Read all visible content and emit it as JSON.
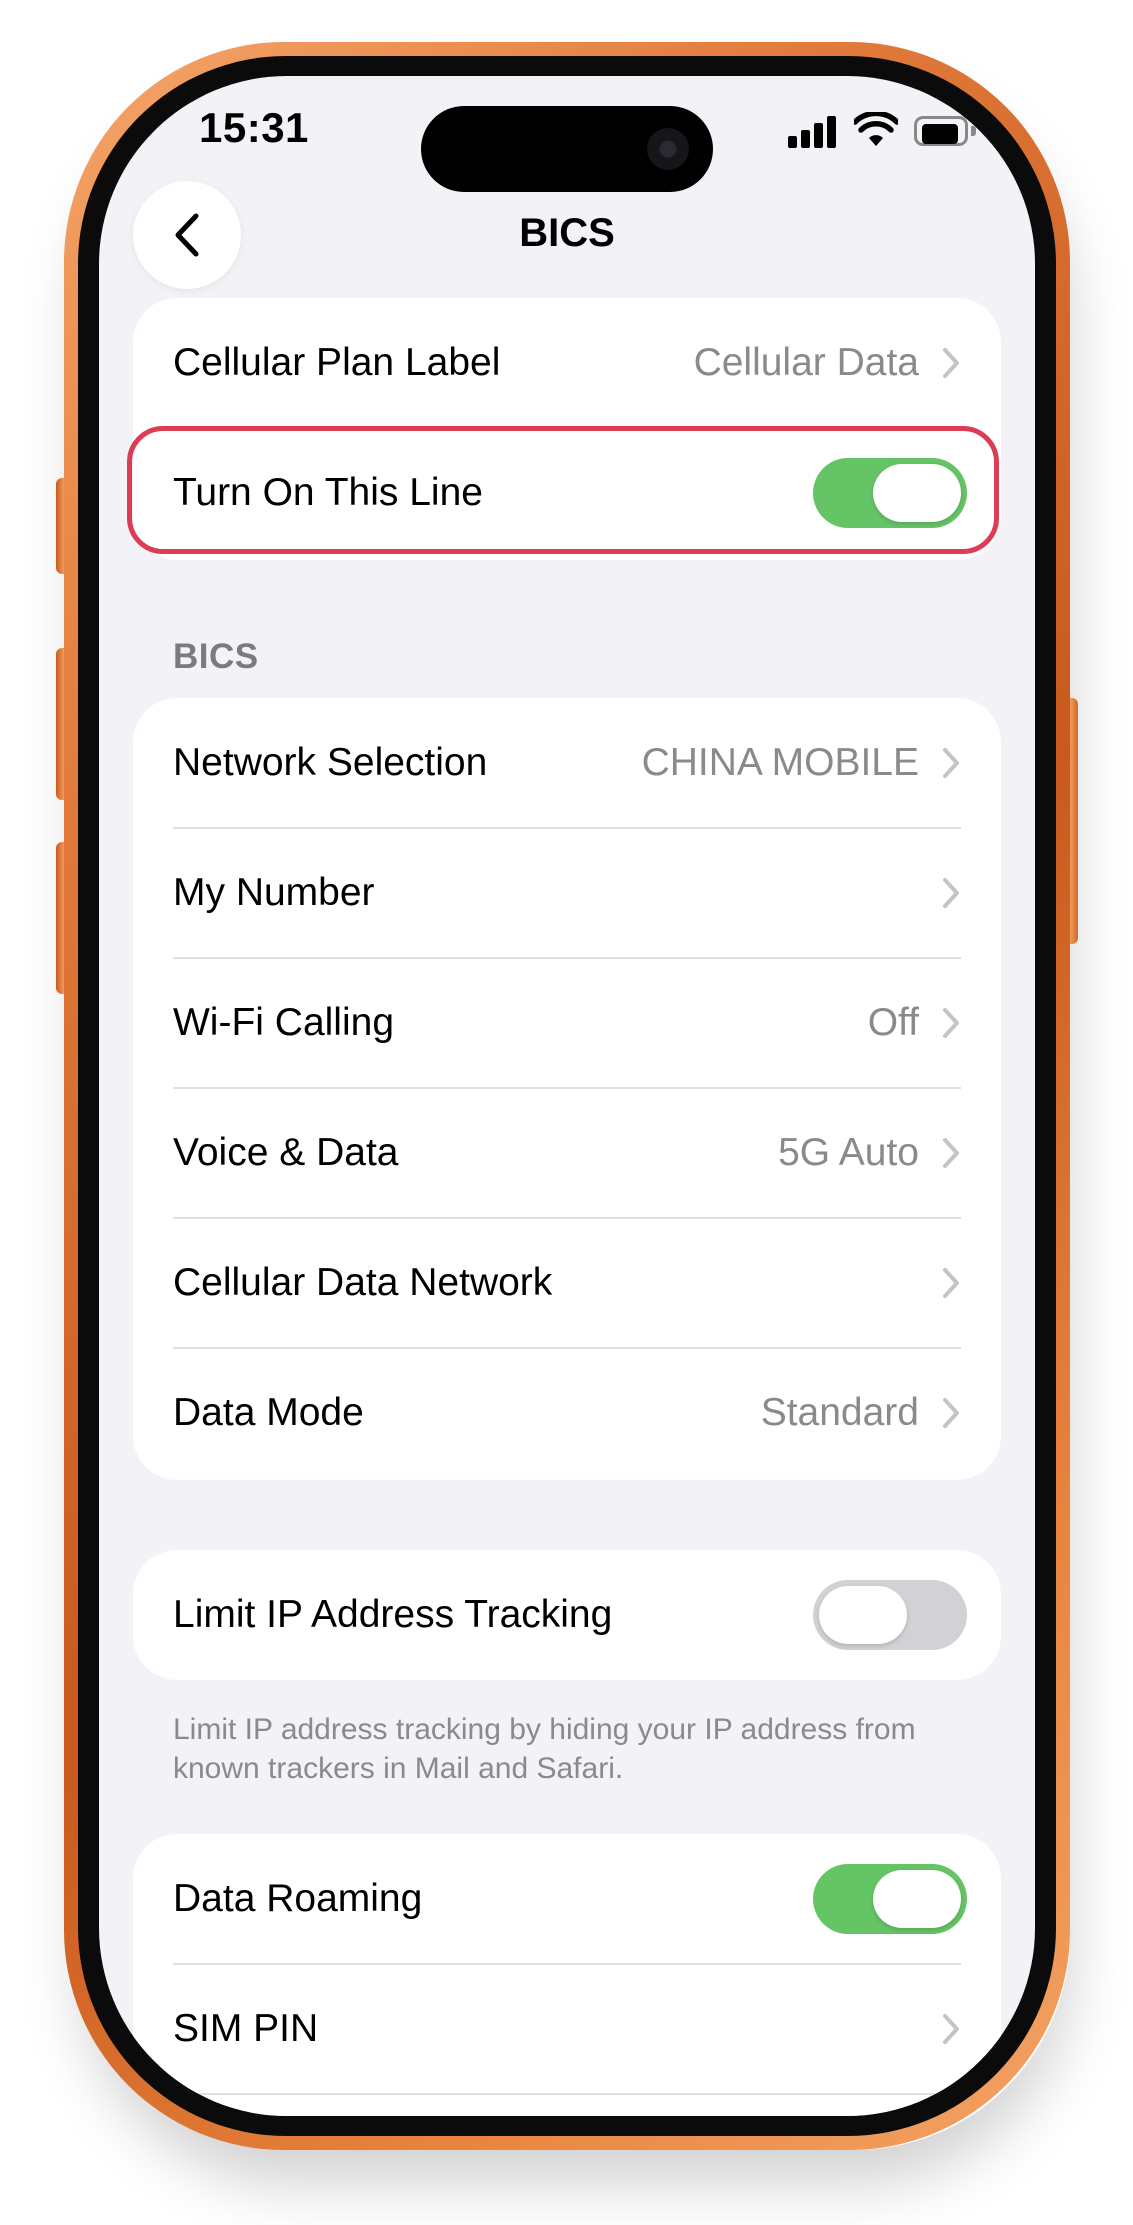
{
  "status_bar": {
    "time": "15:31",
    "icons": [
      "cellular-signal-icon",
      "wifi-icon",
      "battery-icon"
    ]
  },
  "nav": {
    "title": "BICS",
    "back_icon": "chevron-left-icon"
  },
  "plan_group": {
    "cellular_plan_label": {
      "label": "Cellular Plan Label",
      "value": "Cellular Data"
    },
    "turn_on_line": {
      "label": "Turn On This Line",
      "toggle_on": true,
      "highlighted": true
    }
  },
  "bics_section": {
    "header": "BICS",
    "rows": [
      {
        "label": "Network Selection",
        "value": "CHINA MOBILE"
      },
      {
        "label": "My Number",
        "value": ""
      },
      {
        "label": "Wi-Fi Calling",
        "value": "Off"
      },
      {
        "label": "Voice & Data",
        "value": "5G Auto"
      },
      {
        "label": "Cellular Data Network",
        "value": ""
      },
      {
        "label": "Data Mode",
        "value": "Standard"
      }
    ]
  },
  "privacy_group": {
    "limit_ip": {
      "label": "Limit IP Address Tracking",
      "toggle_on": false
    },
    "footnote": "Limit IP address tracking by hiding your IP address from known trackers in Mail and Safari."
  },
  "roaming_group": {
    "data_roaming": {
      "label": "Data Roaming",
      "toggle_on": true
    },
    "sim_pin": {
      "label": "SIM PIN"
    }
  },
  "colors": {
    "toggle_on": "#65c466",
    "toggle_off": "#d1d1d6",
    "highlight": "#dd3c55",
    "frame": "#e07a3a",
    "background": "#f2f2f7"
  }
}
